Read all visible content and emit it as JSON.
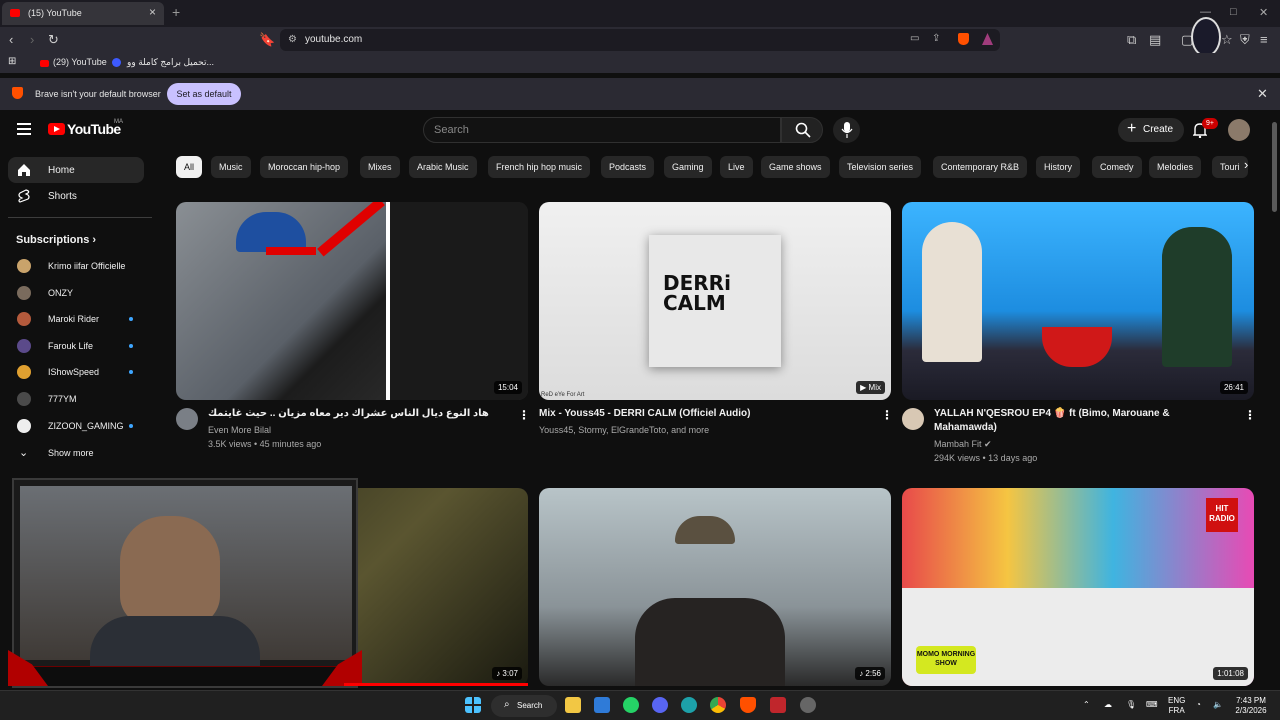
{
  "browser": {
    "tab_title": "(15) YouTube",
    "new_tab": "+",
    "url": "youtube.com",
    "bookmarks": [
      {
        "label": "(29) YouTube"
      },
      {
        "label": "تحميل برامج كاملة وو..."
      }
    ],
    "notice": {
      "message": "Brave isn't your default browser",
      "button": "Set as default"
    }
  },
  "header": {
    "logo": "YouTube",
    "country_code": "MA",
    "search_placeholder": "Search",
    "create_label": "Create",
    "notification_badge": "9+"
  },
  "sidebar": {
    "items": [
      {
        "label": "Home"
      },
      {
        "label": "Shorts"
      }
    ],
    "subscriptions_title": "Subscriptions",
    "subscriptions": [
      {
        "name": "Krimo iifar Officielle",
        "color": "#c9a36b",
        "new": false
      },
      {
        "name": "ONZY",
        "color": "#7a6b5d",
        "new": false
      },
      {
        "name": "Maroki Rider",
        "color": "#b45a3c",
        "new": true
      },
      {
        "name": "Farouk Life",
        "color": "#5b4a8a",
        "new": true
      },
      {
        "name": "IShowSpeed",
        "color": "#e0a030",
        "new": true
      },
      {
        "name": "777YM",
        "color": "#4a4a4a",
        "new": false
      },
      {
        "name": "ZIZOON_GAMING",
        "color": "#eeeeee",
        "new": true
      }
    ],
    "show_more": "Show more"
  },
  "chips": [
    "All",
    "Music",
    "Moroccan hip-hop",
    "Mixes",
    "Arabic Music",
    "French hip hop music",
    "Podcasts",
    "Gaming",
    "Live",
    "Game shows",
    "Television series",
    "Contemporary R&B",
    "History",
    "Comedy",
    "Melodies",
    "Touri"
  ],
  "videos": [
    {
      "title": "هاد النوع ديال الناس عشراك دير معاه مزيان .. حيث غايتمك",
      "channel": "Even More Bilal",
      "stats": "3.5K views • 45 minutes ago",
      "duration": "15:04",
      "verified": false
    },
    {
      "title": "Mix - Youss45 - DERRI CALM (Officiel Audio)",
      "channel": "Youss45, Stormy, ElGrandeToto, and more",
      "stats": "",
      "duration": "Mix",
      "thumb_text": "DERRi CALM",
      "thumb_caption": "ReD eYe For Art",
      "verified": false
    },
    {
      "title": "YALLAH N'QESROU EP4 🍿 ft (Bimo, Marouane & Mahamawda)",
      "channel": "Mambah Fit",
      "stats": "294K views • 13 days ago",
      "duration": "26:41",
      "verified": true
    },
    {
      "duration": "3:07"
    },
    {
      "duration": "2:56"
    },
    {
      "duration": "1:01:08",
      "thumb_text": "HIT RADIO",
      "thumb_caption": "MOMO MORNING SHOW"
    }
  ],
  "taskbar": {
    "search_label": "Search",
    "lang_top": "ENG",
    "lang_bottom": "FRA",
    "time": "7:43 PM",
    "date": "2/3/2026"
  },
  "colors": {
    "brand_red": "#ff0000",
    "background": "#0f0f0f",
    "chip": "#272727"
  }
}
